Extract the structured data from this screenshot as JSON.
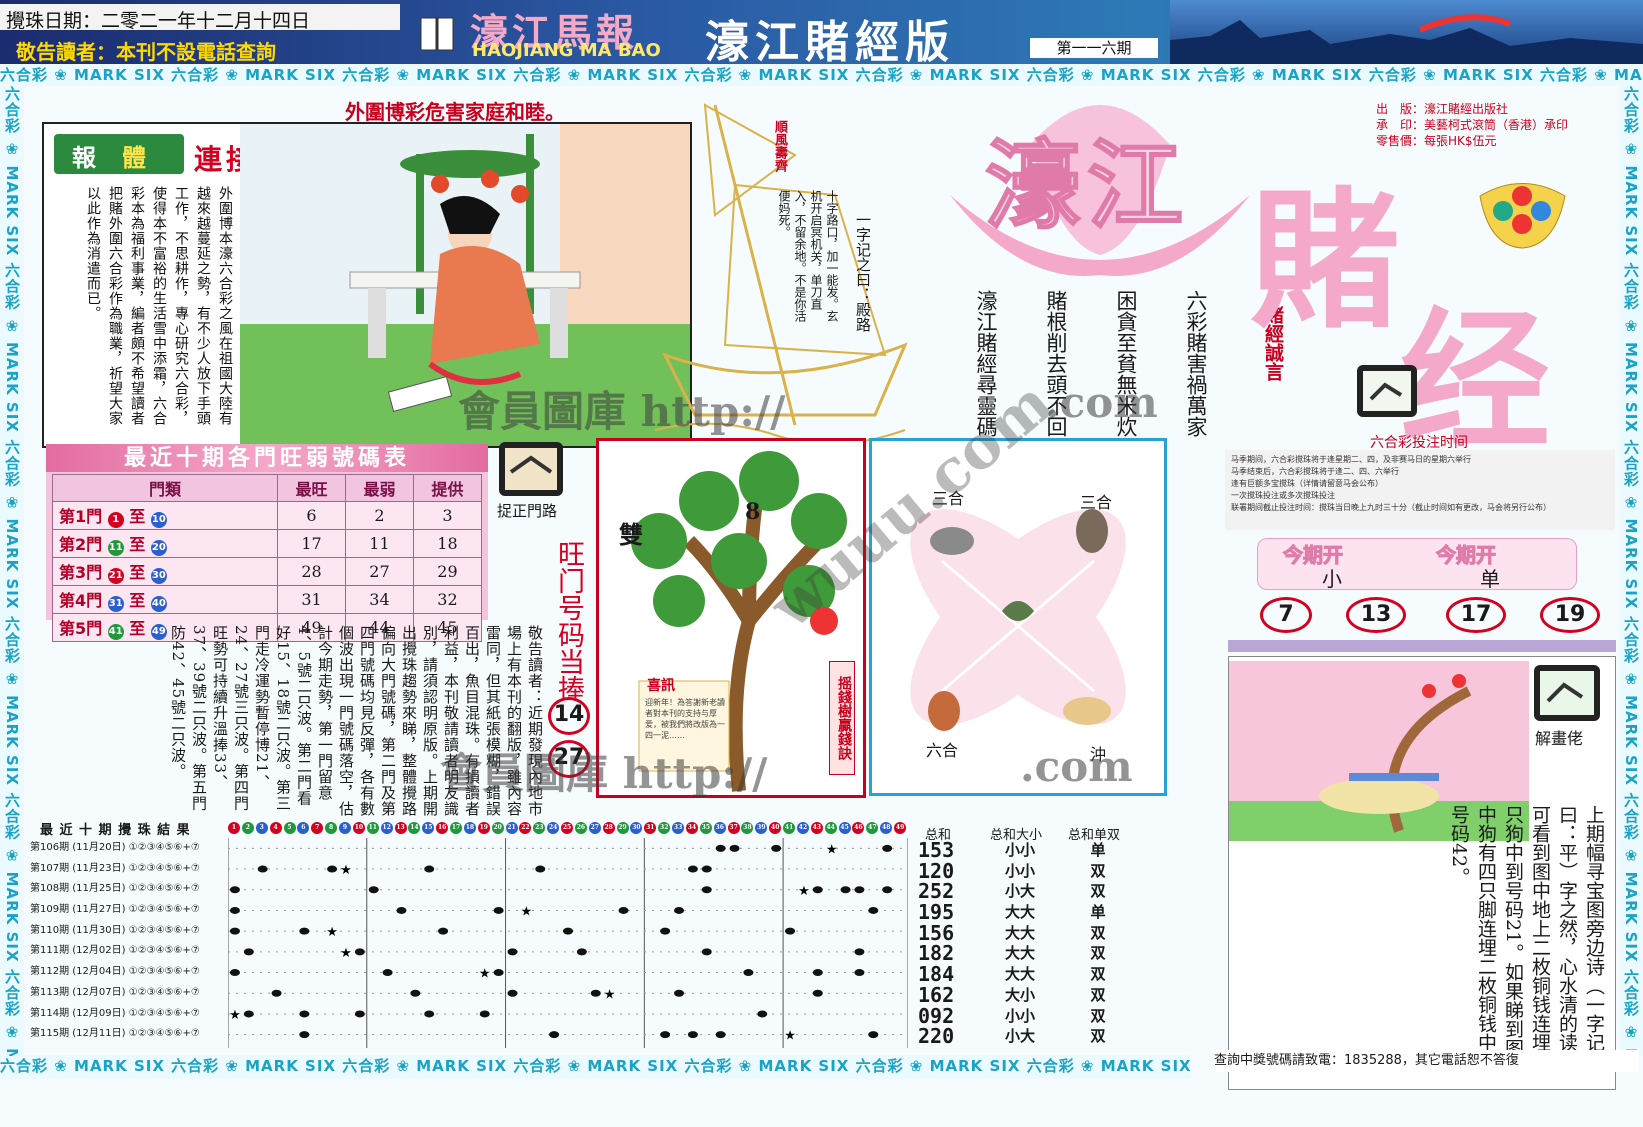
{
  "header": {
    "date_label": "攪珠日期：二零二一年十二月十四日",
    "notice": "敬告讀者：本刊不設電話查詢",
    "brand_cn": "濠江馬報",
    "brand_en": "HAOJIANG MA BAO",
    "edition": "濠江賭經版",
    "issue": "第一一六期"
  },
  "strip_text": "六合彩 ❀ MARK SIX 六合彩 ❀ MARK SIX 六合彩 ❀ MARK SIX 六合彩 ❀ MARK SIX 六合彩 ❀ MARK SIX 六合彩 ❀ MARK SIX 六合彩 ❀ MARK SIX 六合彩 ❀ MARK SIX 六合彩 ❀ MARK SIX 六合彩 ❀ MARK SIX",
  "slogan": "外圍博彩危害家庭和睦。",
  "report": {
    "tag_a": "報",
    "tag_b": "體",
    "tag_c": "連接",
    "body": "外圍博本濠六合彩之風在祖國大陸有越來越蔓延之勢，有不少人放下手頭工作，不思耕作，專心研究六合彩，使得本不富裕的生活雪中添霜，六合彩本為福利事業，編者頗不希望讀者把賭外圍六合彩作為職業，祈望大家以此作為消遣而已。"
  },
  "sail": {
    "flag": "順風壽齊",
    "text1": "一字记之曰：殿路",
    "text2": "十字路口，加一能发。玄机开启冥机关，单刀直入，不留余地。不是你活便妈死。"
  },
  "poems": [
    "六彩賭害禍萬家",
    "困貪至貧無米炊",
    "賭根削去頭不回",
    "濠江賭經尋靈碼"
  ],
  "poem_title": "賭經誠言",
  "publisher": {
    "l1": "出　版：濠江賭經出版社",
    "l2": "承　印：美藝柯式滾筒（香港）承印",
    "l3": "零售價：每張HK$伍元"
  },
  "masthead": {
    "big1": "濠江",
    "big2": "賭",
    "big3": "经"
  },
  "stat_table": {
    "title": "最近十期各門旺弱號碼表",
    "headers": [
      "門類",
      "最旺",
      "最弱",
      "提供"
    ],
    "rows": [
      {
        "door": "第1門",
        "from": "1",
        "to": "10",
        "max": "6",
        "min": "2",
        "give": "3"
      },
      {
        "door": "第2門",
        "from": "11",
        "to": "20",
        "max": "17",
        "min": "11",
        "give": "18"
      },
      {
        "door": "第3門",
        "from": "21",
        "to": "30",
        "max": "28",
        "min": "27",
        "give": "29"
      },
      {
        "door": "第4門",
        "from": "31",
        "to": "40",
        "max": "31",
        "min": "34",
        "give": "32"
      },
      {
        "door": "第5門",
        "from": "41",
        "to": "49",
        "max": "49",
        "min": "44",
        "give": "45"
      }
    ]
  },
  "catch_label": "捉正門路",
  "lucky": {
    "title": "旺门号码当捧",
    "n1": "14",
    "n2": "27"
  },
  "notice_body": "敬告讀者：近期發現內地市場上有本刊的翻版，雖內容雷同，但其紙張模糊，錯誤百出，魚目混珠。有損讀者利益，本刊敬請讀者明友識別，請須認明原版。上期開出攪珠趨勢來睇，整體攪路偏向大門號碼，第二門及第四門號碼均見反彈，各有數個波出現一門號碼落空，估計今期走勢，第一門留意4、5號二只波。第二門看好15、18號二只波。第三門走冷運勢暫停博21、24、27號三只波。第四門旺勢可持續升溫捧33、37、39號二只波。第五門防42、45號二只波。",
  "tree": {
    "tag1": "雙",
    "tag2": "8",
    "title": "喜訊",
    "side": "摇錢樹贏錢訣",
    "note": "迎新年！為答謝新老讀者對本刊的支持与厚爱，被我們將改版為一四一泥……"
  },
  "zodiac": {
    "tl": "三合",
    "tr": "三合",
    "bl": "六合",
    "br": "沖"
  },
  "bet_title": "六合彩投注时间",
  "bet_rules": [
    "马季期间，六合彩搅珠将于逢星期二、四，及非赛马日的星期六举行",
    "马季结束后，六合彩搅珠将于逢二、四、六举行",
    "逢有巨额多宝搅珠（详情请留意马会公布）",
    "一次搅珠投注或多次搅珠投注",
    "联署期间截止投注时间：搅珠当日晚上九时三十分（截止时间如有更改，马会将另行公布）"
  ],
  "period": {
    "h1": "今期开",
    "v1": "小",
    "h2": "今期开",
    "v2": "单",
    "nums": [
      "7",
      "13",
      "17",
      "19"
    ]
  },
  "explain": {
    "label": "解畫佬",
    "body": "上期幅寻宝图旁边诗（一字记之曰：平）字之然，心水清的读者可看到图中地上二枚铜钱连埋一只狗中到号码21。如果睇到图中狗有四只脚连埋二枚铜钱中到号码42。"
  },
  "results": {
    "title": "最 近 十 期 攪 珠 結 果",
    "h_sum": "总和",
    "h_size": "总和大小",
    "h_oe": "总和单双",
    "rows": [
      {
        "p": "第106期",
        "d": "(11月20日)",
        "sum": "153",
        "size": "小小",
        "oe": "单",
        "dots": [
          36,
          37,
          40,
          48
        ],
        "star": 44
      },
      {
        "p": "第107期",
        "d": "(11月23日)",
        "sum": "120",
        "size": "小小",
        "oe": "双",
        "dots": [
          3,
          8,
          15,
          23,
          34,
          35
        ],
        "star": 9
      },
      {
        "p": "第108期",
        "d": "(11月25日)",
        "sum": "252",
        "size": "小大",
        "oe": "双",
        "dots": [
          1,
          11,
          35,
          43,
          45,
          46,
          48
        ],
        "star": 42
      },
      {
        "p": "第109期",
        "d": "(11月27日)",
        "sum": "195",
        "size": "大大",
        "oe": "单",
        "dots": [
          1,
          13,
          20,
          29,
          33,
          47
        ],
        "star": 22
      },
      {
        "p": "第110期",
        "d": "(11月30日)",
        "sum": "156",
        "size": "大大",
        "oe": "双",
        "dots": [
          1,
          6,
          16,
          25,
          32,
          41
        ],
        "star": 8
      },
      {
        "p": "第111期",
        "d": "(12月02日)",
        "sum": "182",
        "size": "大大",
        "oe": "双",
        "dots": [
          2,
          10,
          21,
          26,
          35,
          46
        ],
        "star": 9
      },
      {
        "p": "第112期",
        "d": "(12月04日)",
        "sum": "184",
        "size": "大大",
        "oe": "双",
        "dots": [
          1,
          12,
          20,
          38,
          43,
          46
        ],
        "star": 19
      },
      {
        "p": "第113期",
        "d": "(12月07日)",
        "sum": "162",
        "size": "大小",
        "oe": "双",
        "dots": [
          4,
          14,
          21,
          27,
          33,
          43
        ],
        "star": 28
      },
      {
        "p": "第114期",
        "d": "(12月09日)",
        "sum": "092",
        "size": "小小",
        "oe": "双",
        "dots": [
          2,
          6,
          10,
          15,
          19,
          39
        ],
        "star": 1
      },
      {
        "p": "第115期",
        "d": "(12月11日)",
        "sum": "220",
        "size": "小大",
        "oe": "双",
        "dots": [
          6,
          24,
          32,
          34,
          36,
          47
        ],
        "star": 41
      }
    ]
  },
  "contact": "查詢中獎號碼請致電：1835288，其它電話恕不答復",
  "watermark": {
    "w1": "會員圖庫 http://",
    "w2": ".com",
    "w3": "wuuu.com"
  },
  "colors": {
    "red": "#d4001f",
    "pink": "#f4a9cb",
    "blue": "#1aa3c7"
  }
}
